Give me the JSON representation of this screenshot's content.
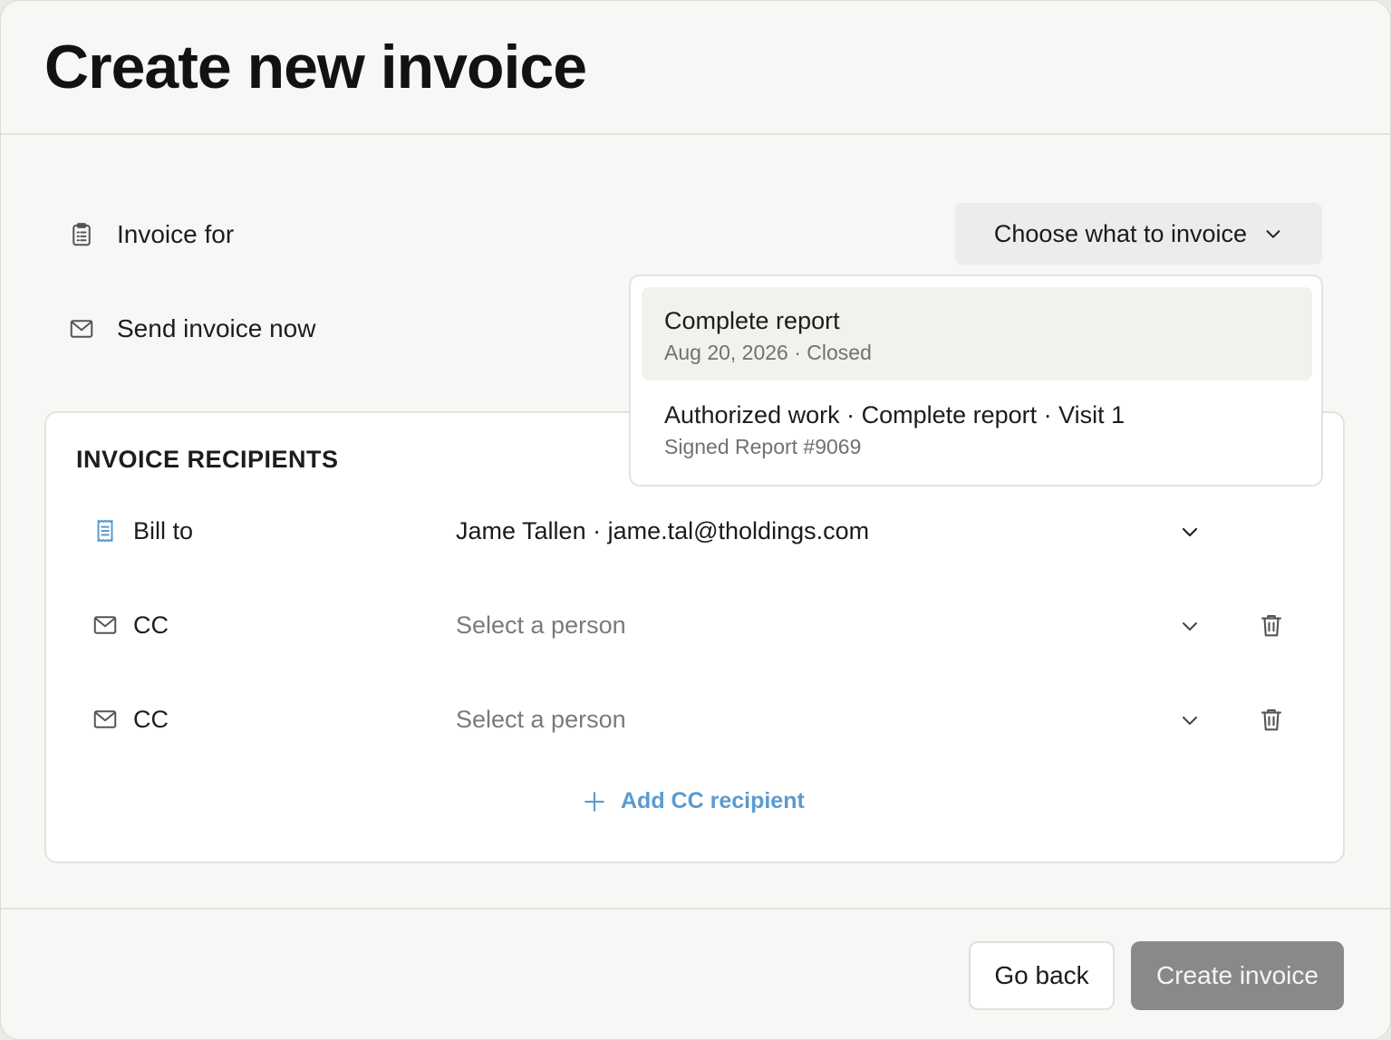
{
  "header": {
    "title": "Create new invoice"
  },
  "invoice_for": {
    "label": "Invoice for",
    "icon": "clipboard-list-icon",
    "button_label": "Choose what to invoice"
  },
  "send_now": {
    "label": "Send invoice now",
    "icon": "mail-icon"
  },
  "dropdown": {
    "options": [
      {
        "title": "Complete report",
        "subtitle": "Aug 20, 2026 · Closed",
        "highlighted": true
      },
      {
        "title": "Authorized work · Complete report · Visit 1",
        "subtitle": "Signed Report #9069",
        "highlighted": false
      }
    ]
  },
  "recipients": {
    "title": "INVOICE RECIPIENTS",
    "rows": [
      {
        "label": "Bill to",
        "icon": "receipt-icon",
        "value": "Jame Tallen · jame.tal@tholdings.com",
        "placeholder": false,
        "deletable": false
      },
      {
        "label": "CC",
        "icon": "mail-icon",
        "value": "Select a person",
        "placeholder": true,
        "deletable": true
      },
      {
        "label": "CC",
        "icon": "mail-icon",
        "value": "Select a person",
        "placeholder": true,
        "deletable": true
      }
    ],
    "add_label": "Add CC recipient"
  },
  "footer": {
    "back_label": "Go back",
    "create_label": "Create invoice"
  },
  "colors": {
    "accent": "#5b9bd0",
    "disabled_button": "#898988",
    "background": "#f7f7f5"
  }
}
